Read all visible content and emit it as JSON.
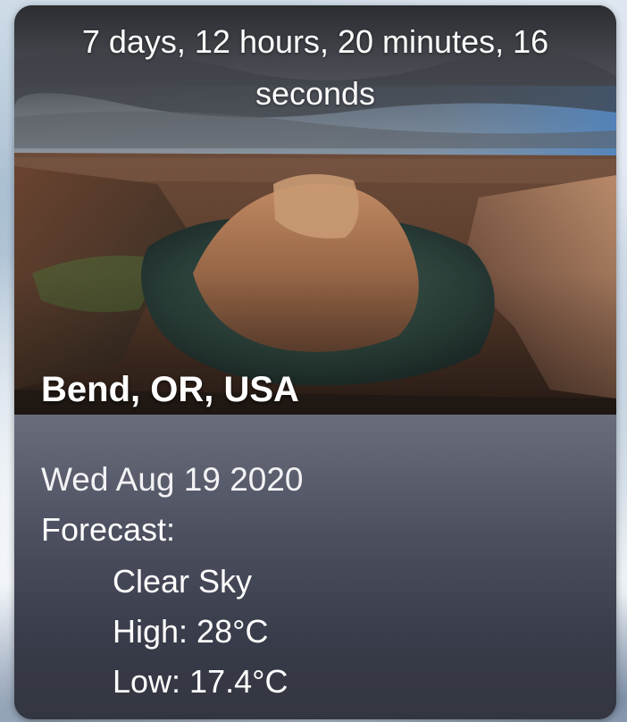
{
  "countdown": "7 days, 12 hours, 20 minutes, 16 seconds",
  "location": "Bend, OR, USA",
  "date": "Wed Aug 19 2020",
  "forecast": {
    "label": "Forecast:",
    "condition": "Clear Sky",
    "high": "High: 28°C",
    "low": "Low: 17.4°C"
  },
  "colors": {
    "info_panel_top": "#6a6d7c",
    "info_panel_bottom": "#33363f",
    "text": "#ffffff"
  }
}
